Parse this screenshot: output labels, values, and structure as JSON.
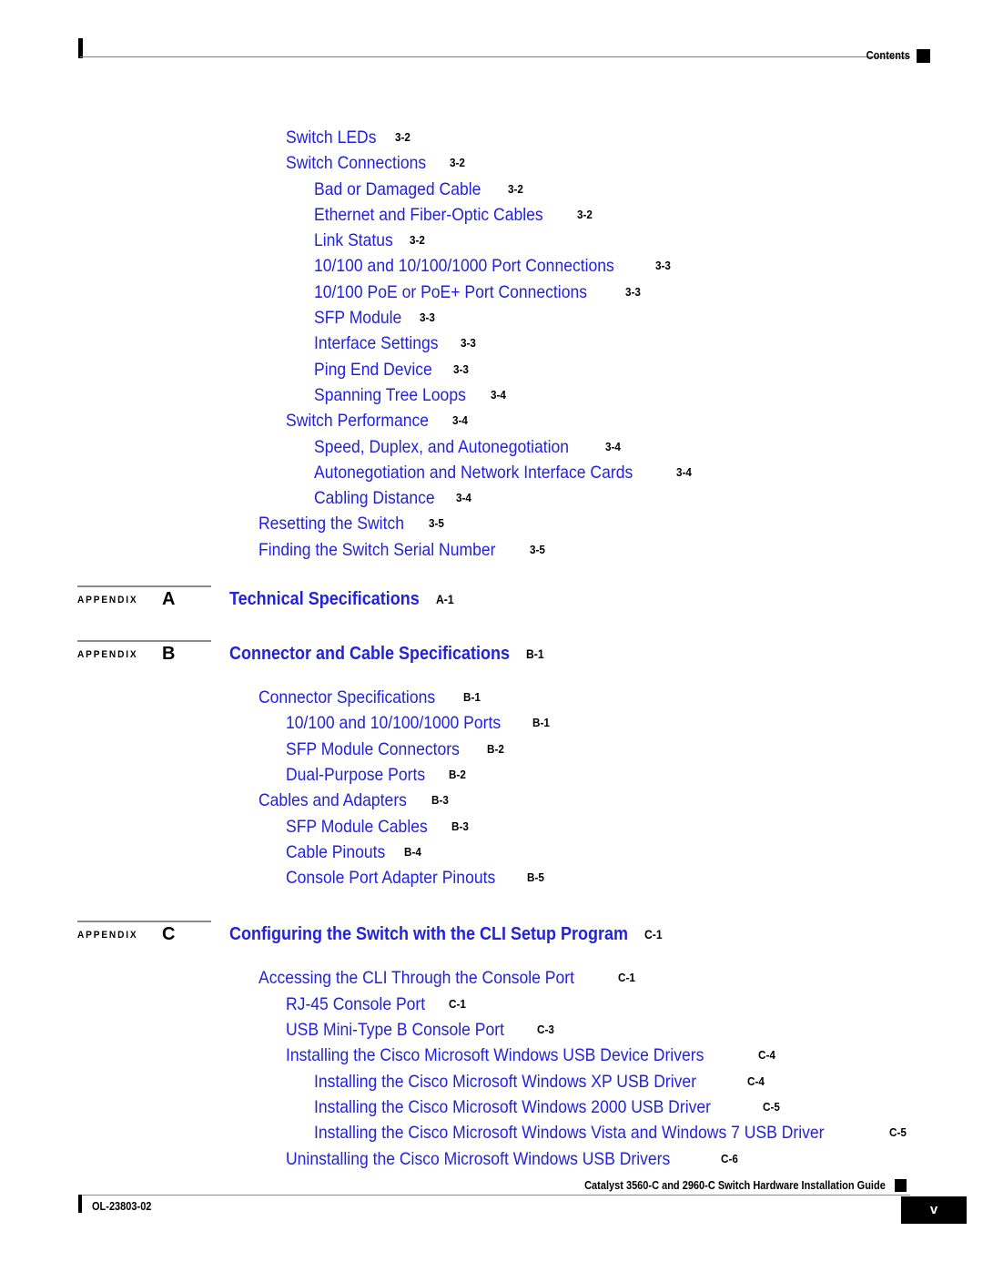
{
  "header": {
    "label": "Contents",
    "marker_color": "#000000"
  },
  "colors": {
    "link_blue": "#2222DD",
    "text_black": "#000000",
    "rule_gray": "#8a8a8a"
  },
  "toc": {
    "entries": [
      {
        "level": 1,
        "title": "Switch LEDs",
        "page": "3-2"
      },
      {
        "level": 1,
        "title": "Switch Connections",
        "page": "3-2"
      },
      {
        "level": 2,
        "title": "Bad or Damaged Cable",
        "page": "3-2"
      },
      {
        "level": 2,
        "title": "Ethernet and Fiber-Optic Cables",
        "page": "3-2"
      },
      {
        "level": 2,
        "title": "Link Status",
        "page": "3-2"
      },
      {
        "level": 2,
        "title": "10/100 and 10/100/1000 Port Connections",
        "page": "3-3"
      },
      {
        "level": 2,
        "title": "10/100 PoE or PoE+ Port Connections",
        "page": "3-3"
      },
      {
        "level": 2,
        "title": "SFP Module",
        "page": "3-3"
      },
      {
        "level": 2,
        "title": "Interface Settings",
        "page": "3-3"
      },
      {
        "level": 2,
        "title": "Ping End Device",
        "page": "3-3"
      },
      {
        "level": 2,
        "title": "Spanning Tree Loops",
        "page": "3-4"
      },
      {
        "level": 1,
        "title": "Switch Performance",
        "page": "3-4"
      },
      {
        "level": 2,
        "title": "Speed, Duplex, and Autonegotiation",
        "page": "3-4"
      },
      {
        "level": 2,
        "title": "Autonegotiation and Network Interface Cards",
        "page": "3-4"
      },
      {
        "level": 2,
        "title": "Cabling Distance",
        "page": "3-4"
      },
      {
        "level": 0,
        "title": "Resetting the Switch",
        "page": "3-5"
      },
      {
        "level": 0,
        "title": "Finding the Switch Serial Number",
        "page": "3-5"
      }
    ]
  },
  "appendices": [
    {
      "word": "APPENDIX",
      "letter": "A",
      "title": "Technical Specifications",
      "page": "A-1",
      "entries": []
    },
    {
      "word": "APPENDIX",
      "letter": "B",
      "title": "Connector and Cable Specifications",
      "page": "B-1",
      "entries": [
        {
          "level": 0,
          "title": "Connector Specifications",
          "page": "B-1"
        },
        {
          "level": 1,
          "title": "10/100 and 10/100/1000 Ports",
          "page": "B-1"
        },
        {
          "level": 1,
          "title": "SFP Module Connectors",
          "page": "B-2"
        },
        {
          "level": 1,
          "title": "Dual-Purpose Ports",
          "page": "B-2"
        },
        {
          "level": 0,
          "title": "Cables and Adapters",
          "page": "B-3"
        },
        {
          "level": 1,
          "title": "SFP Module Cables",
          "page": "B-3"
        },
        {
          "level": 1,
          "title": "Cable Pinouts",
          "page": "B-4"
        },
        {
          "level": 1,
          "title": "Console Port Adapter Pinouts",
          "page": "B-5"
        }
      ]
    },
    {
      "word": "APPENDIX",
      "letter": "C",
      "title": "Configuring the Switch with the CLI Setup Program",
      "page": "C-1",
      "entries": [
        {
          "level": 0,
          "title": "Accessing the CLI Through the Console Port",
          "page": "C-1"
        },
        {
          "level": 1,
          "title": "RJ-45 Console Port",
          "page": "C-1"
        },
        {
          "level": 1,
          "title": "USB Mini-Type B Console Port",
          "page": "C-3"
        },
        {
          "level": 1,
          "title": "Installing the Cisco Microsoft Windows USB Device Drivers",
          "page": "C-4"
        },
        {
          "level": 2,
          "title": "Installing the Cisco Microsoft Windows XP USB Driver",
          "page": "C-4"
        },
        {
          "level": 2,
          "title": "Installing the Cisco Microsoft Windows 2000 USB Driver",
          "page": "C-5"
        },
        {
          "level": 2,
          "title": "Installing the Cisco Microsoft Windows Vista and Windows 7 USB Driver",
          "page": "C-5"
        },
        {
          "level": 1,
          "title": "Uninstalling the Cisco Microsoft Windows USB Drivers",
          "page": "C-6"
        }
      ]
    }
  ],
  "footer": {
    "guide_title": "Catalyst 3560-C and 2960-C Switch Hardware Installation Guide",
    "doc_id": "OL-23803-02",
    "page_number": "v"
  }
}
